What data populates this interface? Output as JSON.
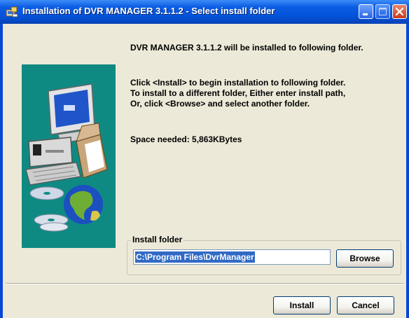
{
  "window": {
    "title": "Installation of DVR MANAGER 3.1.1.2 - Select install folder",
    "title_icon": "installer-icon",
    "controls": [
      "minimize-icon",
      "maximize-icon",
      "close-icon"
    ]
  },
  "body": {
    "heading": "DVR MANAGER 3.1.1.2 will be installed to following folder.",
    "instructions": [
      "Click <Install> to begin installation to following folder.",
      "To install to a different folder, Either enter install path,",
      "Or, click <Browse> and select another folder."
    ],
    "space_needed": "Space needed: 5,863KBytes"
  },
  "install_folder": {
    "label": "Install folder",
    "path": "C:\\Program Files\\DvrManager",
    "browse_label": "Browse"
  },
  "buttons": {
    "install": "Install",
    "cancel": "Cancel"
  },
  "colors": {
    "title_bar": "#0452d8",
    "dialog_bg": "#ece9d8",
    "art_bg": "#0f8a83",
    "selection": "#316ac5"
  }
}
